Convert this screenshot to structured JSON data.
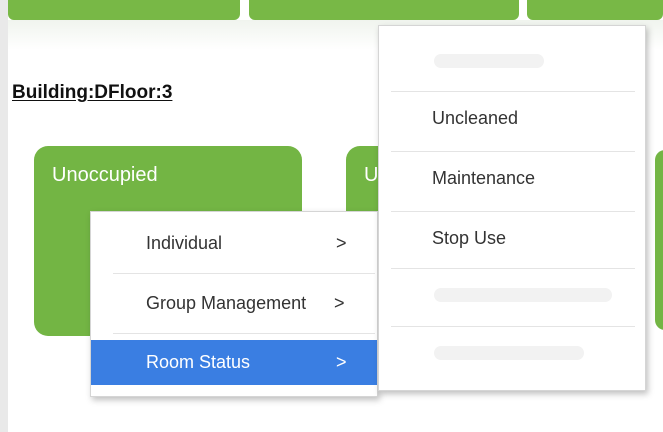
{
  "location": {
    "title": "Building:DFloor:3"
  },
  "rooms": [
    {
      "status": "Unoccupied"
    },
    {
      "status": "U"
    }
  ],
  "context_menu": {
    "items": [
      {
        "label": "Individual",
        "arrow": ">"
      },
      {
        "label": "Group Management",
        "arrow": ">"
      },
      {
        "label": "Room Status",
        "arrow": ">"
      }
    ],
    "active_index": 2
  },
  "status_submenu": {
    "items": [
      {
        "label": "Uncleaned"
      },
      {
        "label": "Maintenance"
      },
      {
        "label": "Stop Use"
      }
    ]
  },
  "colors": {
    "room_green": "#73b544",
    "top_bar_green": "#78b846",
    "menu_highlight": "#3a7ee2"
  }
}
